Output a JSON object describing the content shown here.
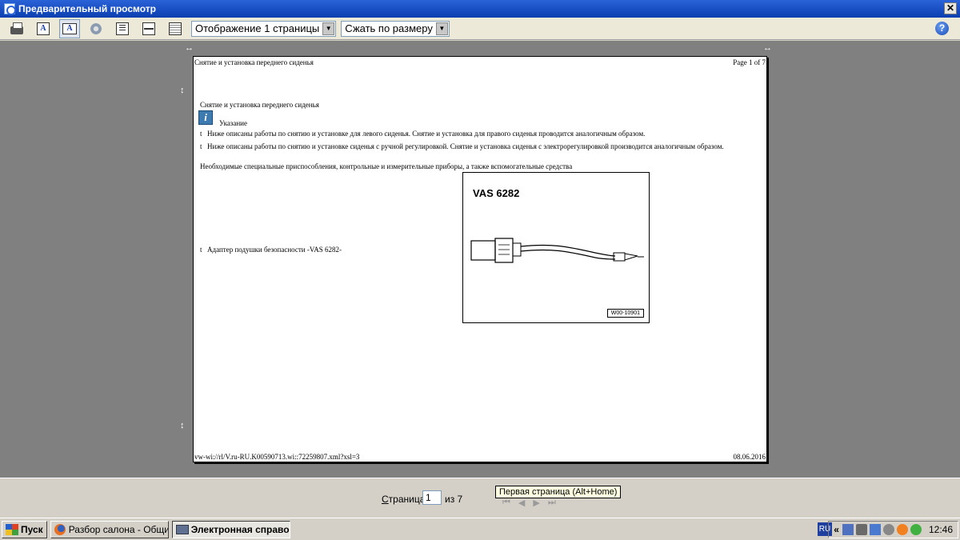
{
  "window": {
    "title": "Предварительный просмотр",
    "close_label": "✕"
  },
  "toolbar": {
    "display_mode": "Отображение 1 страницы",
    "zoom_mode": "Сжать по размеру",
    "help_label": "?"
  },
  "document": {
    "header_left": "Снятие и установка переднего сиденья",
    "header_right": "Page 1 of 7",
    "title": "Снятие и установка переднего сиденья",
    "note_label": "Указание",
    "bullet_marker": "t",
    "bullets": [
      "Ниже описаны работы по снятию и установке для левого сиденья. Снятие и установка для правого сиденья проводится аналогичным образом.",
      "Ниже описаны работы по снятию и установке сиденья с ручной регулировкой. Снятие и установка сиденья с электрорегулировкой производится аналогичным образом."
    ],
    "tools_line": "Необходимые специальные приспособления, контрольные и измерительные приборы, а также вспомогательные средства",
    "adapter_item": "Адаптер подушки безопасности -VAS 6282-",
    "figure": {
      "title": "VAS 6282",
      "code": "W00-10901"
    },
    "footer_left": "vw-wi://rl/V.ru-RU.K00590713.wi::72259807.xml?xsl=3",
    "footer_right": "08.06.2016"
  },
  "navigation": {
    "page_label_prefix": "С",
    "page_label_rest": "траница",
    "current_page": "1",
    "of_label": "из 7",
    "tooltip": "Первая страница (Alt+Home)"
  },
  "taskbar": {
    "start_label": "Пуск",
    "tasks": [
      "Разбор салона - Общие...",
      "Электронная справо..."
    ],
    "language": "RU",
    "tray_chevron": "«",
    "clock": "12:46"
  }
}
